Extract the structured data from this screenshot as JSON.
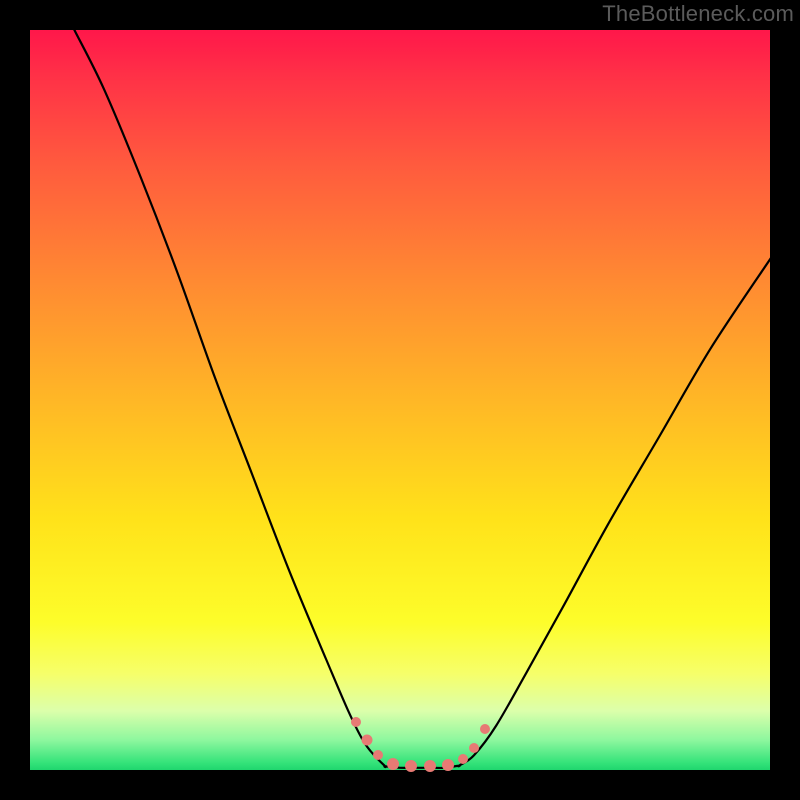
{
  "watermark": "TheBottleneck.com",
  "chart_data": {
    "type": "line",
    "title": "",
    "xlabel": "",
    "ylabel": "",
    "xlim": [
      0,
      100
    ],
    "ylim": [
      0,
      100
    ],
    "grid": false,
    "legend": false,
    "series": [
      {
        "name": "left-curve",
        "x": [
          6,
          10,
          15,
          20,
          25,
          30,
          35,
          40,
          43,
          45,
          46.5,
          48
        ],
        "y": [
          100,
          92,
          80,
          67,
          53,
          40,
          27,
          15,
          8,
          4,
          2,
          0.5
        ]
      },
      {
        "name": "valley-floor",
        "x": [
          48,
          50,
          52,
          54,
          56,
          58
        ],
        "y": [
          0.5,
          0.3,
          0.3,
          0.3,
          0.3,
          0.6
        ]
      },
      {
        "name": "right-curve",
        "x": [
          58,
          60,
          63,
          67,
          72,
          78,
          85,
          92,
          100
        ],
        "y": [
          0.6,
          2,
          6,
          13,
          22,
          33,
          45,
          57,
          69
        ]
      }
    ],
    "markers": [
      {
        "x": 44,
        "y": 6.5,
        "size": 10
      },
      {
        "x": 45.5,
        "y": 4,
        "size": 11
      },
      {
        "x": 47,
        "y": 2,
        "size": 10
      },
      {
        "x": 49,
        "y": 0.8,
        "size": 12
      },
      {
        "x": 51.5,
        "y": 0.6,
        "size": 12
      },
      {
        "x": 54,
        "y": 0.6,
        "size": 12
      },
      {
        "x": 56.5,
        "y": 0.7,
        "size": 12
      },
      {
        "x": 58.5,
        "y": 1.5,
        "size": 10
      },
      {
        "x": 60,
        "y": 3,
        "size": 10
      },
      {
        "x": 61.5,
        "y": 5.5,
        "size": 10
      }
    ],
    "colors": {
      "curve": "#000000",
      "marker": "#e77a74",
      "gradient_top": "#ff174a",
      "gradient_mid": "#ffe21a",
      "gradient_bottom": "#1fd66e"
    }
  }
}
